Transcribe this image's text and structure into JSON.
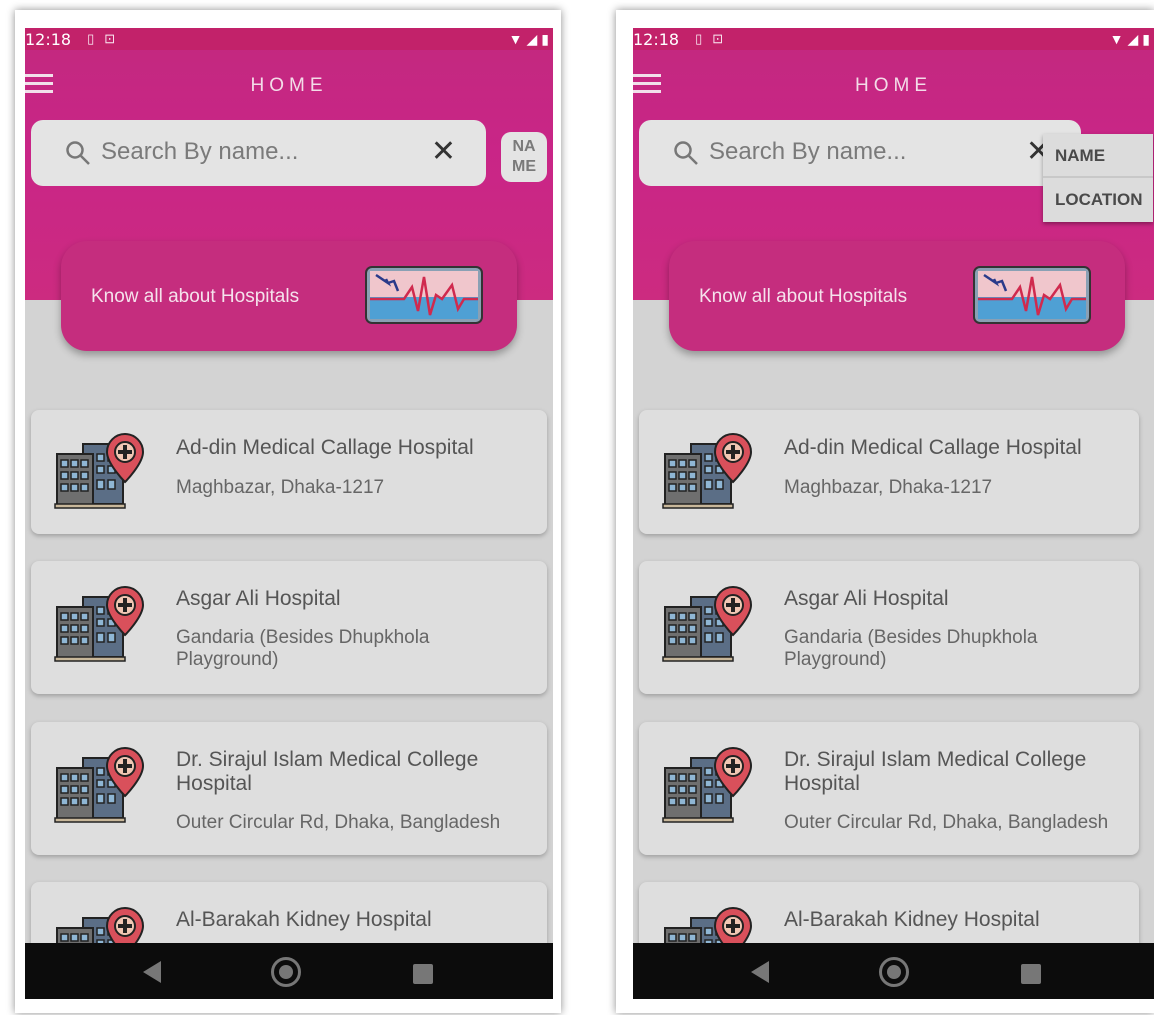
{
  "status_bar": {
    "time": "12:18"
  },
  "app_bar": {
    "title": "HOME"
  },
  "search": {
    "placeholder": "Search By name...",
    "clear_symbol": "✕"
  },
  "filter_chip": {
    "label_line1": "NA",
    "label_line2": "ME"
  },
  "filter_dropdown": {
    "options": [
      "NAME",
      "LOCATION"
    ]
  },
  "banner": {
    "text": "Know all about Hospitals"
  },
  "hospitals": [
    {
      "name": "Ad-din Medical Callage Hospital",
      "address": "Maghbazar, Dhaka-1217"
    },
    {
      "name": "Asgar Ali Hospital",
      "address": "Gandaria (Besides Dhupkhola Playground)"
    },
    {
      "name": "Dr. Sirajul Islam Medical College Hospital",
      "address": "Outer Circular Rd, Dhaka, Bangladesh"
    },
    {
      "name": "Al-Barakah Kidney Hospital",
      "address": ""
    }
  ],
  "colors": {
    "primary": "#c92587",
    "banner": "#c52d7e",
    "background": "#d3d3d3"
  },
  "icons": [
    "menu-icon",
    "search-icon",
    "close-icon",
    "heartbeat-monitor-icon",
    "hospital-building-icon",
    "back-nav-icon",
    "home-nav-icon",
    "recents-nav-icon"
  ]
}
